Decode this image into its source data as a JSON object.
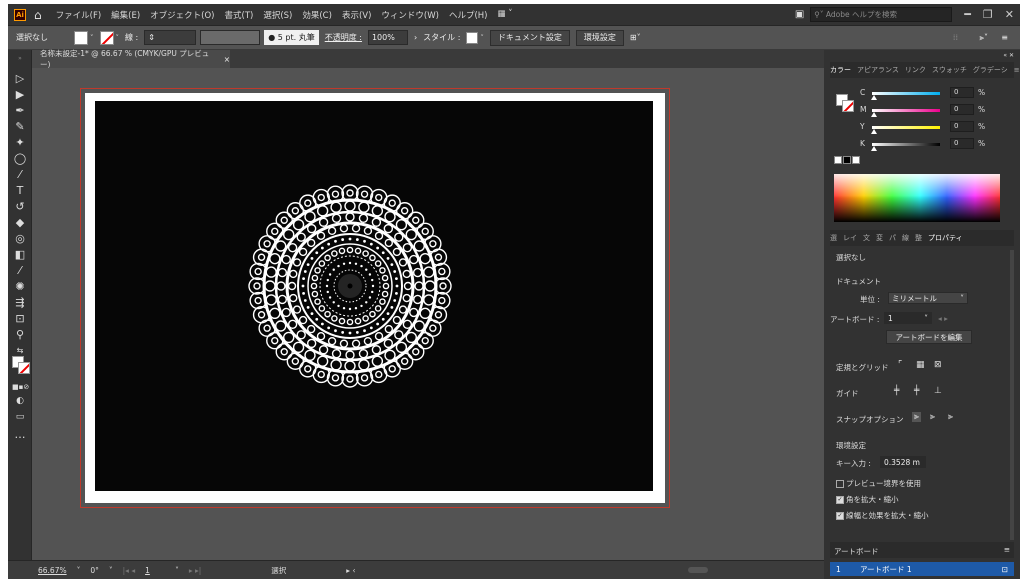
{
  "menubar": {
    "logo": "Ai",
    "items": [
      "ファイル(F)",
      "編集(E)",
      "オブジェクト(O)",
      "書式(T)",
      "選択(S)",
      "効果(C)",
      "表示(V)",
      "ウィンドウ(W)",
      "ヘルプ(H)"
    ],
    "search_placeholder": "Adobe ヘルプを検索"
  },
  "controlbar": {
    "selection": "選択なし",
    "stroke_label": "線 :",
    "stroke_size": "5 pt. 丸筆",
    "opacity_label": "不透明度 :",
    "opacity_value": "100%",
    "style_label": "スタイル :",
    "doc_settings": "ドキュメント設定",
    "preferences": "環境設定"
  },
  "document_tab": {
    "title": "名称未設定-1* @ 66.67 % (CMYK/GPU プレビュー)",
    "close": "×"
  },
  "statusbar": {
    "zoom": "66.67%",
    "rotation": "0°",
    "artboard_num": "1",
    "tool": "選択"
  },
  "color_panel": {
    "tabs": [
      "カラー",
      "アピアランス",
      "リンク",
      "スウォッチ",
      "グラデーシ"
    ],
    "channels": [
      {
        "label": "C",
        "value": "0",
        "color": "#00aeef"
      },
      {
        "label": "M",
        "value": "0",
        "color": "#ec008c"
      },
      {
        "label": "Y",
        "value": "0",
        "color": "#fff200"
      },
      {
        "label": "K",
        "value": "0",
        "color": "#bbbbbb"
      }
    ],
    "percent": "%"
  },
  "properties_panel": {
    "tabs": [
      "選",
      "レイ",
      "文",
      "変",
      "パ",
      "線",
      "整",
      "プロパティ"
    ],
    "selection": "選択なし",
    "document": "ドキュメント",
    "units_label": "単位 :",
    "units_value": "ミリメートル",
    "artboard_label": "アートボード :",
    "artboard_value": "1",
    "edit_artboard": "アートボードを編集",
    "rulers_grids": "定規とグリッド",
    "guides": "ガイド",
    "snap_options": "スナップオプション",
    "preferences": "環境設定",
    "key_input_label": "キー入力 :",
    "key_input_value": "0.3528 m",
    "preview_bounds": "プレビュー境界を使用",
    "scale_corners": "角を拡大・縮小",
    "scale_strokes": "線幅と効果を拡大・縮小"
  },
  "artboards_panel": {
    "title": "アートボード",
    "row_index": "1",
    "row_name": "アートボード 1"
  }
}
